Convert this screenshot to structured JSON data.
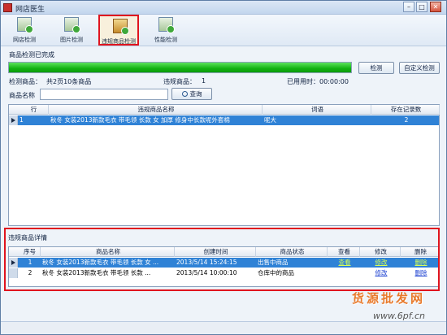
{
  "window": {
    "title": "网店医生",
    "minimize": "–",
    "maximize": "□",
    "close": "✕"
  },
  "toolbar": {
    "tools": [
      {
        "label": "网店检测"
      },
      {
        "label": "图片检测"
      },
      {
        "label": "违规商品检测"
      },
      {
        "label": "性能检测"
      }
    ]
  },
  "progress": {
    "caption": "商品检测已完成",
    "value": 1.0,
    "check_label": "检测",
    "custom_check_label": "自定义检测"
  },
  "info": {
    "checked": "检测商品：",
    "count_text": "共2页10条商品",
    "violations": "违规商品：",
    "violation_count": "1",
    "elapsed": "已用用时：00:00:00"
  },
  "search": {
    "label": "商品名称",
    "value": "",
    "query_label": "查询"
  },
  "top_grid": {
    "columns": [
      "行",
      "违规商品名称",
      "词语",
      "存在记录数"
    ],
    "rows": [
      {
        "index": "1",
        "name": "秋冬 女装2013新款毛衣 带毛领 长款 女 加厚 修身中长款呢外套棉",
        "word": "呢大",
        "count": "2"
      }
    ]
  },
  "section": {
    "title": "违规商品详情"
  },
  "bottom_grid": {
    "columns": [
      "序号",
      "商品名称",
      "创建时间",
      "商品状态",
      "查看",
      "修改",
      "删除"
    ],
    "rows": [
      {
        "index": "1",
        "name": "秋冬 女装2013新款毛衣 带毛领 长款 女 ...",
        "created": "2013/5/14 15:24:15",
        "status": "出售中商品",
        "view": "查看",
        "edit": "修改",
        "delete": "删除"
      },
      {
        "index": "2",
        "name": "秋冬 女装2013新款毛衣 带毛领 长款 ...",
        "created": "2013/5/14 10:00:10",
        "status": "仓库中的商品",
        "view": "",
        "edit": "修改",
        "delete": "删除"
      }
    ]
  },
  "watermark": {
    "text": "货源批发网",
    "url": "www.6pf.cn"
  },
  "colors": {
    "accent": "#2f82d6",
    "progress": "#12b212",
    "highlight": "#e0141e"
  },
  "icons": [
    "shop-check-icon",
    "image-check-icon",
    "violation-check-icon",
    "performance-check-icon",
    "search-icon"
  ]
}
